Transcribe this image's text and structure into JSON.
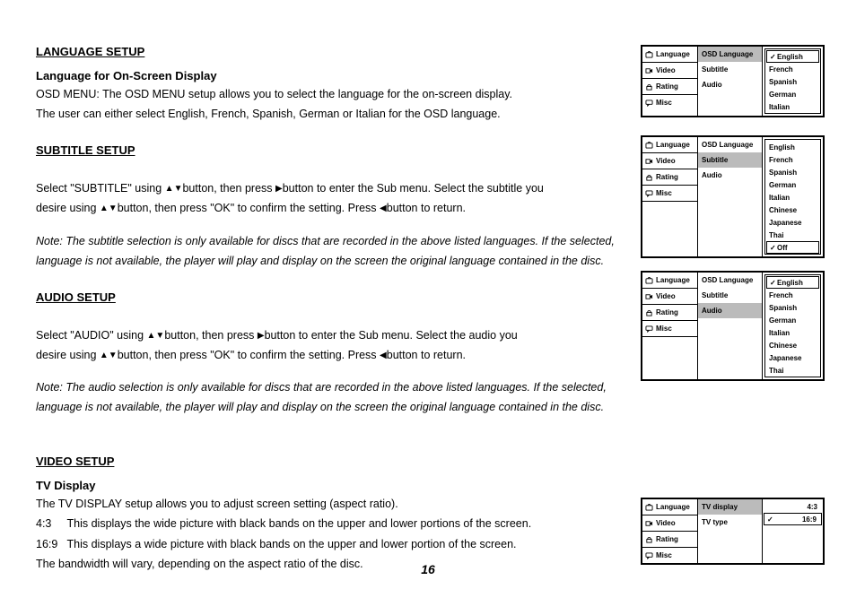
{
  "page_number": "16",
  "triangles": {
    "up": "▲",
    "down": "▼",
    "left": "◀",
    "right": "▶"
  },
  "sections": {
    "lang": {
      "title": "LANGUAGE SETUP",
      "sub": "Language for On-Screen Display",
      "p1": "OSD MENU: The OSD MENU setup allows you to select the language for the on-screen display.",
      "p2": "The user can either select English, French, Spanish, German or Italian for the OSD language."
    },
    "subtitle": {
      "title": "SUBTITLE SETUP",
      "p1a": "Select \"SUBTITLE\" using ",
      "p1b": "button, then press ",
      "p1c": "button to enter the Sub menu. Select the subtitle you",
      "p2a": "desire using ",
      "p2b": "button, then press \"OK\" to confirm the setting. Press ",
      "p2c": "button to return.",
      "note1": "Note: The subtitle selection is only available for discs that are recorded in the above listed languages. If the selected,",
      "note2": "language is not available, the player will play and display on the screen the original language contained in the disc."
    },
    "audio": {
      "title": "AUDIO SETUP",
      "p1a": "Select \"AUDIO\" using ",
      "p1b": "button, then press ",
      "p1c": "button to enter the Sub menu. Select the audio you",
      "p2a": "desire using ",
      "p2b": "button, then press \"OK\" to confirm the setting. Press ",
      "p2c": "button to return.",
      "note1": "Note: The audio selection is only available for discs that are recorded in the above listed languages. If the selected,",
      "note2": "language is not available, the player will play and display on the screen the original language contained in the disc."
    },
    "video": {
      "title": "VIDEO SETUP",
      "sub": "TV Display",
      "p1": "The TV DISPLAY setup allows you to adjust screen setting (aspect ratio).",
      "p2": "4:3     This displays the wide picture with black bands on the upper and lower portions of the screen.",
      "p3": "16:9   This displays a wide picture with black bands on the upper and lower portion of the screen.",
      "p4": "The bandwidth will vary, depending on the aspect ratio of the disc."
    }
  },
  "osd": {
    "side": [
      "Language",
      "Video",
      "Rating",
      "Misc"
    ],
    "mid_lang": [
      "OSD Language",
      "Subtitle",
      "Audio"
    ],
    "opts1": [
      "English",
      "French",
      "Spanish",
      "German",
      "Italian"
    ],
    "opts2": [
      "English",
      "French",
      "Spanish",
      "German",
      "Italian",
      "Chinese",
      "Japanese",
      "Thai",
      "Off"
    ],
    "opts3": [
      "English",
      "French",
      "Spanish",
      "German",
      "Italian",
      "Chinese",
      "Japanese",
      "Thai"
    ],
    "mid_video": [
      "TV display",
      "TV type"
    ],
    "opts4": [
      "4:3",
      "16:9"
    ]
  }
}
